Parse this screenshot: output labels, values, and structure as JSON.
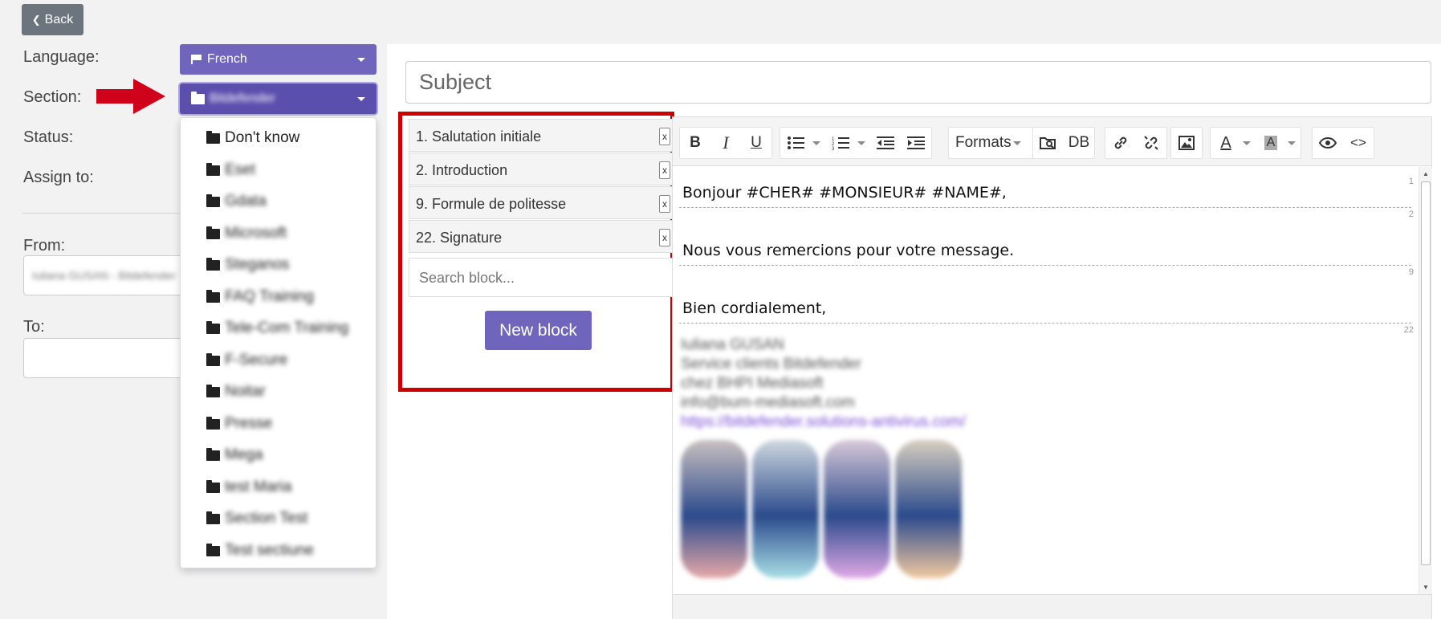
{
  "back_label": "Back",
  "labels": {
    "language": "Language:",
    "section": "Section:",
    "status": "Status:",
    "assign_to": "Assign to:",
    "from": "From:",
    "to": "To:"
  },
  "language_value": "French",
  "section_value": "Bitdefender",
  "from_value": "Iuliana GUSAN - Bitdefender",
  "section_options": [
    "Don't know",
    "Eset",
    "Gdata",
    "Microsoft",
    "Steganos",
    "FAQ Training",
    "Tele-Com Training",
    "F-Secure",
    "Noitar",
    "Presse",
    "Mega",
    "test Maria",
    "Section Test",
    "Test sectiune"
  ],
  "subject_placeholder": "Subject",
  "blocks": [
    {
      "label": "1. Salutation initiale",
      "remove": "x"
    },
    {
      "label": "2. Introduction",
      "remove": "x"
    },
    {
      "label": "9. Formule de politesse",
      "remove": "x"
    },
    {
      "label": "22. Signature",
      "remove": "x"
    }
  ],
  "search_block_placeholder": "Search block...",
  "new_block_label": "New block",
  "toolbar": {
    "bold": "B",
    "italic": "I",
    "underline": "U",
    "formats": "Formats",
    "db": "DB",
    "source_code": "<>"
  },
  "editor_paragraphs": [
    {
      "num": "1",
      "text": "Bonjour #CHER# #MONSIEUR# #NAME#,"
    },
    {
      "num": "2",
      "text": "Nous vous remercions pour votre message."
    },
    {
      "num": "9",
      "text": "Bien cordialement,"
    },
    {
      "num": "22",
      "text": ""
    }
  ],
  "signature_lines": [
    "Iuliana GUSAN",
    "Service clients Bitdefender",
    "chez BHPI Mediasoft",
    "info@bum-mediasoft.com",
    "https://bitdefender.solutions-antivirus.com/"
  ],
  "colors": {
    "accent": "#7065bc",
    "highlight_border": "#cc0000",
    "arrow": "#d0021b",
    "back_button": "#6c757d"
  }
}
